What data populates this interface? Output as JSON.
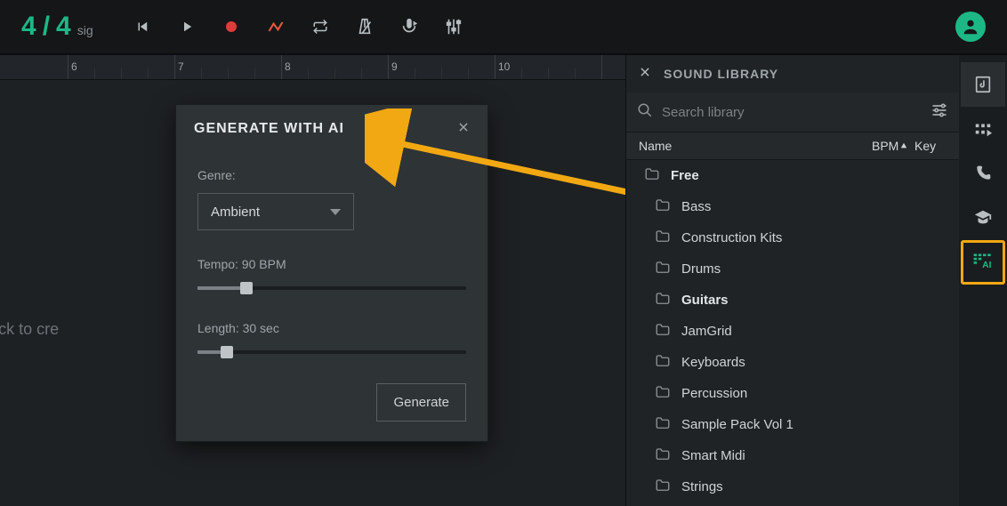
{
  "topbar": {
    "sig_numerator": "4",
    "sig_slash": "/",
    "sig_denominator": "4",
    "sig_label": "sig"
  },
  "timeline": {
    "tick_labels": [
      "6",
      "7",
      "8",
      "9",
      "10"
    ],
    "placeholder": "here or double click to cre"
  },
  "modal": {
    "title": "GENERATE WITH AI",
    "genre_label": "Genre:",
    "genre_value": "Ambient",
    "tempo_label": "Tempo: 90 BPM",
    "length_label": "Length: 30 sec",
    "generate": "Generate"
  },
  "library": {
    "title": "SOUND LIBRARY",
    "search_placeholder": "Search library",
    "col_name": "Name",
    "col_bpm": "BPM",
    "col_key": "Key",
    "items": [
      {
        "label": "Free",
        "indent": false,
        "bold": true
      },
      {
        "label": "Bass",
        "indent": true,
        "bold": false
      },
      {
        "label": "Construction Kits",
        "indent": true,
        "bold": false
      },
      {
        "label": "Drums",
        "indent": true,
        "bold": false
      },
      {
        "label": "Guitars",
        "indent": true,
        "bold": true
      },
      {
        "label": "JamGrid",
        "indent": true,
        "bold": false
      },
      {
        "label": "Keyboards",
        "indent": true,
        "bold": false
      },
      {
        "label": "Percussion",
        "indent": true,
        "bold": false
      },
      {
        "label": "Sample Pack Vol 1",
        "indent": true,
        "bold": false
      },
      {
        "label": "Smart Midi",
        "indent": true,
        "bold": false
      },
      {
        "label": "Strings",
        "indent": true,
        "bold": false
      }
    ]
  }
}
